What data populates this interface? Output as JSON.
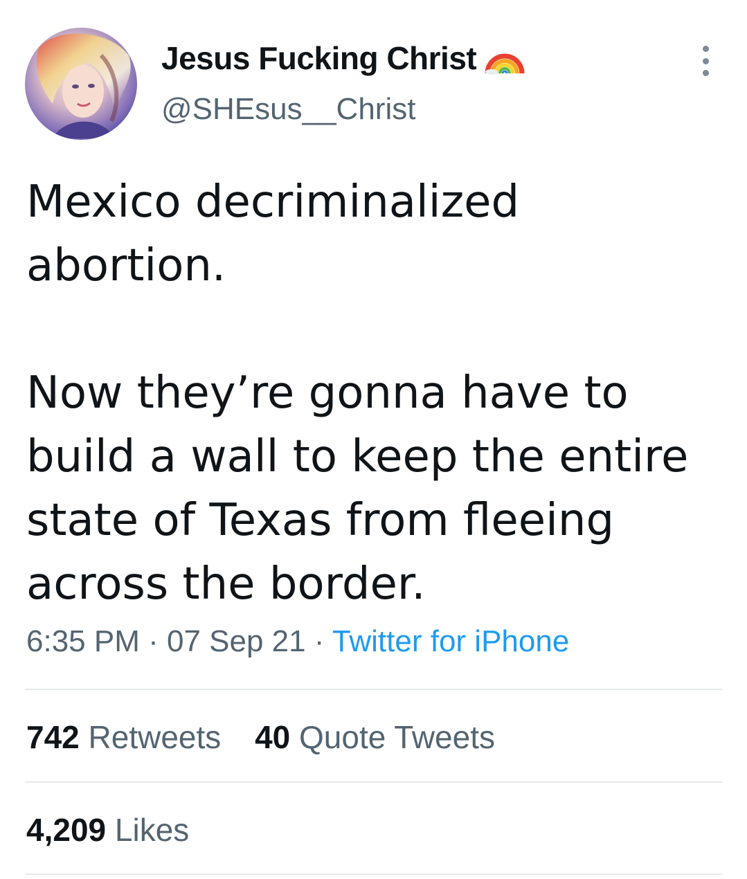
{
  "author": {
    "display_name": "Jesus Fucking Christ",
    "name_emoji": "rainbow-icon",
    "handle": "@SHEsus__Christ",
    "avatar": "profile-avatar-illustration"
  },
  "more_icon": "more-options-icon",
  "tweet": {
    "paragraphs": [
      [
        "Mexico decriminalized",
        "abortion."
      ],
      [
        "Now they’re gonna have to",
        "build a wall to keep the entire",
        "state of Texas from fleeing",
        "across the border."
      ]
    ]
  },
  "meta": {
    "time": "6:35 PM",
    "separator": " · ",
    "date": "07 Sep 21",
    "source": "Twitter for iPhone"
  },
  "stats": {
    "retweets_count": "742",
    "retweets_label": "Retweets",
    "quotes_count": "40",
    "quotes_label": "Quote Tweets",
    "likes_count": "4,209",
    "likes_label": "Likes"
  },
  "colors": {
    "text_primary": "#0f1419",
    "text_secondary": "#536471",
    "link": "#1d9bf0",
    "divider": "#e6e9eb"
  }
}
